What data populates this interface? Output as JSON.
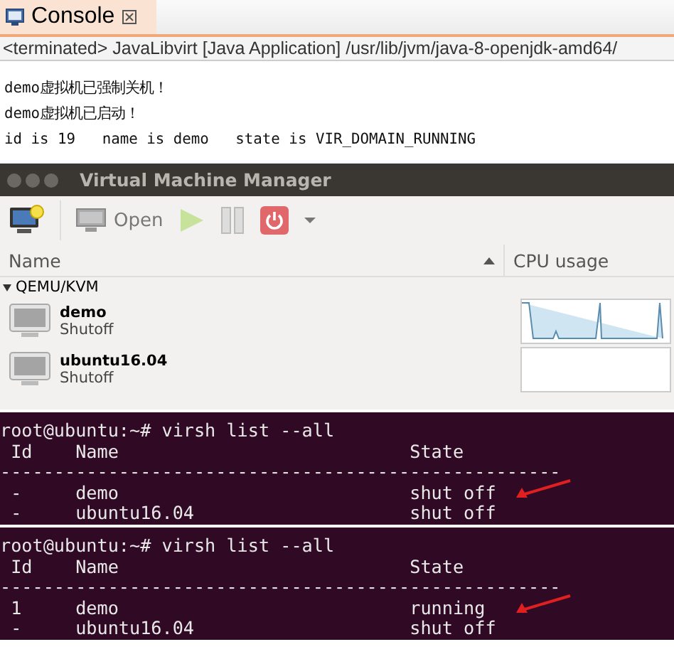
{
  "console": {
    "tab": {
      "label": "Console",
      "selected": true
    },
    "launch": "<terminated> JavaLibvirt [Java Application] /usr/lib/jvm/java-8-openjdk-amd64/",
    "output": [
      "demo虚拟机已强制关机！",
      "demo虚拟机已启动！",
      "id is 19   name is demo   state is VIR_DOMAIN_RUNNING"
    ]
  },
  "vmm": {
    "window": {
      "title": "Virtual Machine Manager"
    },
    "toolbar": {
      "open": "Open"
    },
    "columns": [
      "Name",
      "CPU usage"
    ],
    "group": {
      "label": "QEMU/KVM",
      "expanded": true
    },
    "vms": [
      {
        "name": "demo",
        "state": "Shutoff",
        "cpu_graph": true
      },
      {
        "name": "ubuntu16.04",
        "state": "Shutoff",
        "cpu_graph": false
      }
    ]
  },
  "terminals": [
    {
      "prompt": "root@ubuntu:~# virsh list --all",
      "header": " Id    Name                           State",
      "rule": "----------------------------------------------------",
      "rows": [
        {
          "text": " -     demo                           shut off",
          "marked": true
        },
        {
          "text": " -     ubuntu16.04                    shut off",
          "marked": false
        }
      ]
    },
    {
      "prompt": "root@ubuntu:~# virsh list --all",
      "header": " Id    Name                           State",
      "rule": "----------------------------------------------------",
      "rows": [
        {
          "text": " 1     demo                           running",
          "marked": true
        },
        {
          "text": " -     ubuntu16.04                    shut off",
          "marked": false
        }
      ]
    }
  ]
}
